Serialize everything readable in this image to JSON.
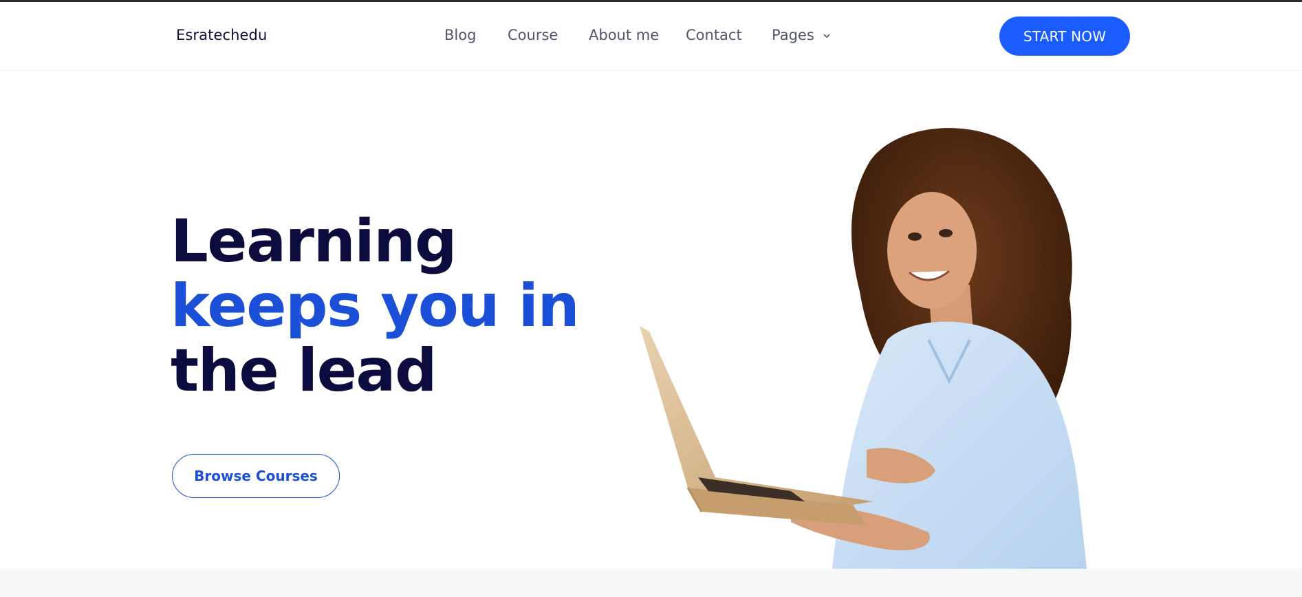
{
  "header": {
    "logo": "Esratechedu",
    "nav": [
      {
        "label": "Blog"
      },
      {
        "label": "Course"
      },
      {
        "label": "About me"
      },
      {
        "label": "Contact"
      },
      {
        "label": "Pages",
        "has_dropdown": true
      }
    ],
    "cta_label": "START NOW"
  },
  "hero": {
    "headline_line1": "Learning",
    "headline_line2": "keeps you in",
    "headline_line3": "the lead",
    "button_label": "Browse Courses",
    "image": "woman-with-laptop"
  },
  "colors": {
    "accent_blue": "#1a5cff",
    "headline_dark": "#0b0b3d",
    "headline_blue": "#1b4fd8",
    "nav_text": "#51566a"
  },
  "icons": {
    "pages_dropdown": "chevron-down-icon"
  }
}
